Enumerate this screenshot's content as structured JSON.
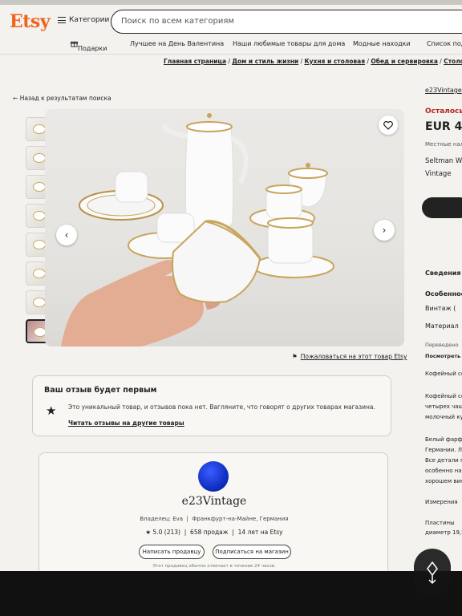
{
  "header": {
    "logo": "Etsy",
    "categories_label": "Категории",
    "search_placeholder": "Поиск по всем категориям"
  },
  "nav": {
    "gifts": "Подарки",
    "valentine": "Лучшее на День Валентина",
    "home": "Наши любимые товары для дома",
    "trends": "Модные находки",
    "list": "Список под"
  },
  "breadcrumbs": [
    "Главная страница",
    "Дом и стиль жизни",
    "Кухня и столовая",
    "Обед и сервировка",
    "Столовые сер"
  ],
  "back_label": "Назад к результатам поиска",
  "report_label": "Пожаловаться на этот товар Etsy",
  "review": {
    "title": "Ваш отзыв будет первым",
    "text": "Это уникальный товар, и отзывов пока нет. Вагляните, что говорят о других товарах магазина.",
    "link": "Читать отзывы на другие товары"
  },
  "shop": {
    "name": "e23Vintage",
    "owner": "Владелец: Eva",
    "location": "Франкфурт-на-Майне, Германия",
    "rating": "5.0 (213)",
    "sales": "658 продаж",
    "years": "14 лет на Etsy",
    "message_btn": "Написать продавцу",
    "follow_btn": "Подписаться на магазин",
    "note": "Этот продавец обычно отвечает в течение 24 часов."
  },
  "right": {
    "shop": "e23Vintage",
    "stock": "Осталось",
    "price": "EUR 4",
    "local": "Местные нал",
    "title1": "Seltman W",
    "title2": "Vintage",
    "details": "Сведения о",
    "features": "Особенност",
    "vintage": "Винтаж (",
    "material": "Материал",
    "translated": "Переведено",
    "show": "Посмотреть",
    "desc1": "Кофейный сер",
    "desc2": "Кофейный сер",
    "desc3": "четырех чашеч",
    "desc4": "молочный кувш",
    "desc5": "Белый фарфор",
    "desc6": "Германии. Лей",
    "desc7": "Все детали пок",
    "desc8": "особенно на об",
    "desc9": "хорошем винта",
    "measure": "Измерения",
    "plates": "Пластины",
    "diameter": "диаметр 19,5 см"
  },
  "colors": {
    "etsy_orange": "#f1641e",
    "gold_trim": "#c8a45c",
    "shop_logo": "#1a3fe0"
  }
}
